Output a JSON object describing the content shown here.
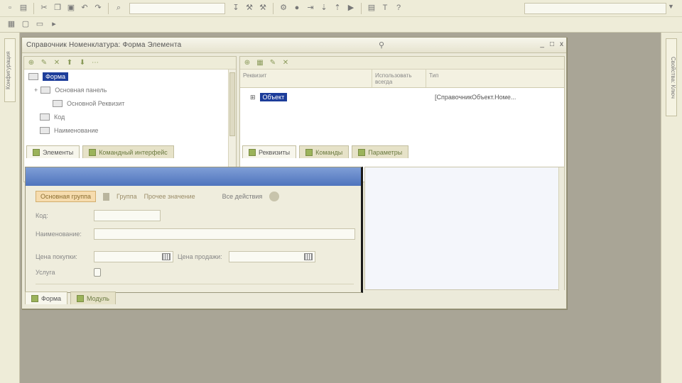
{
  "toolbar": {
    "row1_icons": [
      "new-icon",
      "open-icon",
      "cut-icon",
      "copy-icon",
      "paste-icon",
      "undo-icon",
      "redo-icon",
      "search-icon"
    ],
    "row2_icons": [
      "layout-icon",
      "window-icon",
      "arrow-icon"
    ]
  },
  "left_rail": {
    "tab_label": "Конфигурация"
  },
  "right_rail": {
    "tab_label": "Свойства: Ключ"
  },
  "window": {
    "title": "Справочник Номенклатура: Форма Элемента",
    "controls": [
      "_",
      "□",
      "x"
    ]
  },
  "tree": {
    "items": [
      {
        "label": "Форма",
        "selected": true,
        "indent": 0
      },
      {
        "label": "Основная панель",
        "selected": false,
        "indent": 1
      },
      {
        "label": "Основной Реквизит",
        "selected": false,
        "indent": 2
      },
      {
        "label": "Код",
        "selected": false,
        "indent": 1
      },
      {
        "label": "Наименование",
        "selected": false,
        "indent": 1
      }
    ],
    "tabs": [
      "Элементы",
      "Командный интерфейс"
    ]
  },
  "list": {
    "columns": [
      "Реквизит",
      "Использовать всегда",
      "Тип"
    ],
    "rows": [
      {
        "name": "Объект",
        "type": "[СправочникОбъект.Номе..."
      }
    ],
    "tabs": [
      "Реквизиты",
      "Команды",
      "Параметры"
    ]
  },
  "form": {
    "tabs": {
      "main": "Основная группа",
      "second": "Группа",
      "third": "Прочее значение",
      "right": "Все действия"
    },
    "fields": {
      "code_label": "Код:",
      "name_label": "Наименование:",
      "purchase_label": "Цена покупки:",
      "sale_label": "Цена продажи:",
      "service_label": "Услуга"
    },
    "bottom_tabs": [
      "Форма",
      "Модуль"
    ]
  }
}
